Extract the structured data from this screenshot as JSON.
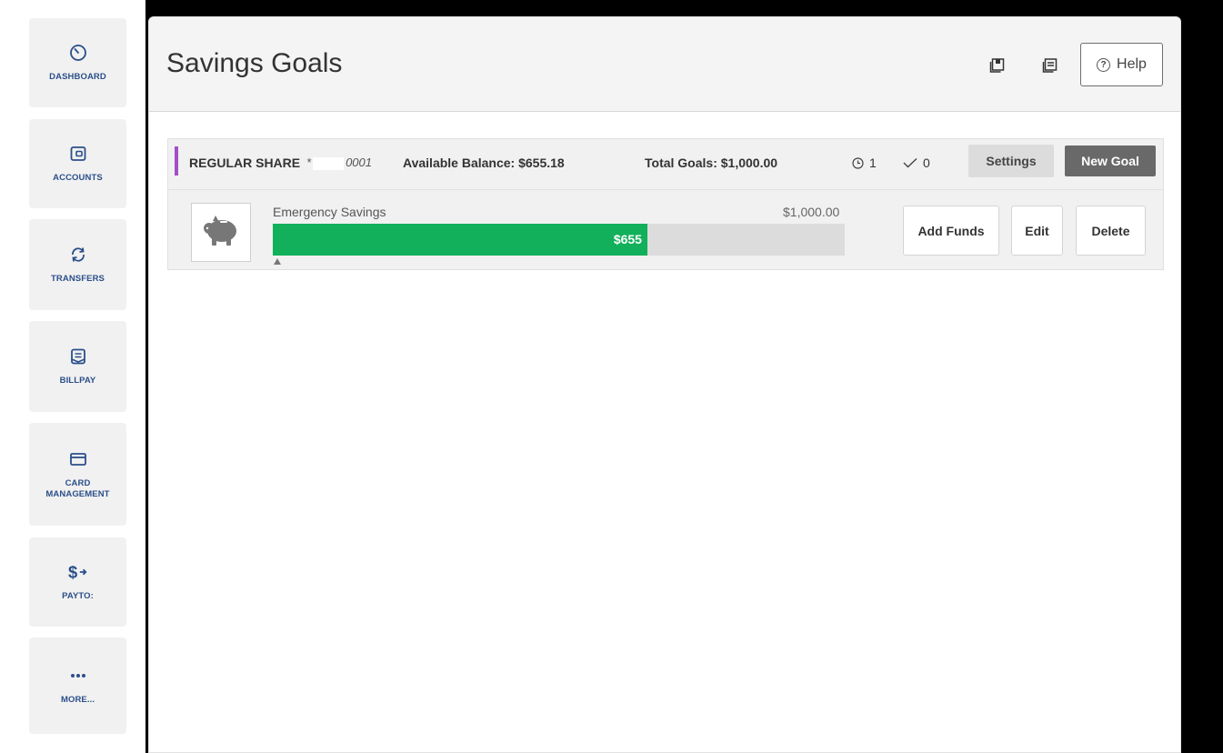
{
  "nav": {
    "items": [
      {
        "label": "DASHBOARD",
        "icon": "gauge-icon"
      },
      {
        "label": "ACCOUNTS",
        "icon": "wallet-icon"
      },
      {
        "label": "TRANSFERS",
        "icon": "transfer-arrows-icon"
      },
      {
        "label": "BILLPAY",
        "icon": "bill-icon"
      },
      {
        "label": "CARD\nMANAGEMENT",
        "icon": "credit-card-icon"
      },
      {
        "label": "PAYTO:",
        "icon": "dollar-arrow-icon"
      },
      {
        "label": "MORE...",
        "icon": "ellipsis-icon"
      }
    ]
  },
  "header": {
    "title": "Savings Goals",
    "help_label": "Help"
  },
  "account": {
    "name": "REGULAR SHARE",
    "mask_prefix": "*",
    "mask_suffix": "0001",
    "available_balance": "Available Balance: $655.18",
    "total_goals": "Total Goals: $1,000.00",
    "in_progress_count": "1",
    "completed_count": "0",
    "settings_label": "Settings",
    "new_goal_label": "New Goal",
    "accent_color": "#a44fc7"
  },
  "goal": {
    "name": "Emergency Savings",
    "target": "$1,000.00",
    "current": "$655",
    "progress_fraction": 0.655,
    "progress_color": "#12b05a",
    "add_funds_label": "Add Funds",
    "edit_label": "Edit",
    "delete_label": "Delete",
    "image_icon": "piggy-bank-icon"
  }
}
